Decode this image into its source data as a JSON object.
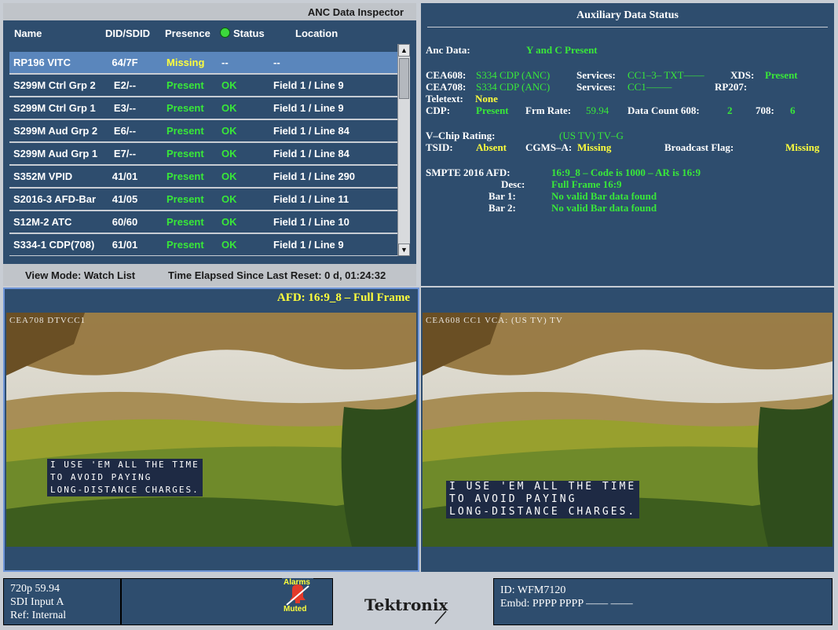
{
  "anc_inspector": {
    "title": "ANC Data Inspector",
    "headers": {
      "name": "Name",
      "did": "DID/SDID",
      "presence": "Presence",
      "status": "Status",
      "location": "Location"
    },
    "rows": [
      {
        "name": "RP196 VITC",
        "did": "64/7F",
        "presence": "Missing",
        "status": "--",
        "location": "--"
      },
      {
        "name": "S299M Ctrl Grp 2",
        "did": "E2/--",
        "presence": "Present",
        "status": "OK",
        "location": "Field 1 / Line 9"
      },
      {
        "name": "S299M Ctrl Grp 1",
        "did": "E3/--",
        "presence": "Present",
        "status": "OK",
        "location": "Field 1 / Line 9"
      },
      {
        "name": "S299M Aud Grp 2",
        "did": "E6/--",
        "presence": "Present",
        "status": "OK",
        "location": "Field 1 / Line 84"
      },
      {
        "name": "S299M Aud Grp 1",
        "did": "E7/--",
        "presence": "Present",
        "status": "OK",
        "location": "Field 1 / Line 84"
      },
      {
        "name": "S352M VPID",
        "did": "41/01",
        "presence": "Present",
        "status": "OK",
        "location": "Field 1 / Line 290"
      },
      {
        "name": "S2016-3 AFD-Bar",
        "did": "41/05",
        "presence": "Present",
        "status": "OK",
        "location": "Field 1 / Line 11"
      },
      {
        "name": "S12M-2 ATC",
        "did": "60/60",
        "presence": "Present",
        "status": "OK",
        "location": "Field 1 / Line 10"
      },
      {
        "name": "S334-1 CDP(708)",
        "did": "61/01",
        "presence": "Present",
        "status": "OK",
        "location": "Field 1 / Line 9"
      }
    ],
    "view_mode": "View Mode: Watch List",
    "time_elapsed": "Time Elapsed Since Last Reset: 0 d, 01:24:32"
  },
  "aux_status": {
    "title": "Auxiliary Data Status",
    "anc_data_label": "Anc Data:",
    "anc_data_value": "Y and C Present",
    "cea608_label": "CEA608:",
    "cea608_value": "S334 CDP (ANC)",
    "cea608_services_label": "Services:",
    "cea608_services_value": "CC1–3– TXT––––",
    "xds_label": "XDS:",
    "xds_value": "Present",
    "cea708_label": "CEA708:",
    "cea708_value": "S334 CDP (ANC)",
    "cea708_services_label": "Services:",
    "cea708_services_value": "CC1–––––",
    "rp207_label": "RP207:",
    "teletext_label": "Teletext:",
    "teletext_value": "None",
    "cdp_label": "CDP:",
    "cdp_value": "Present",
    "frm_rate_label": "Frm Rate:",
    "frm_rate_value": "59.94",
    "data_count_label": "Data Count 608:",
    "data_count_608": "2",
    "data_count_708_label": "708:",
    "data_count_708": "6",
    "vchip_label": "V–Chip Rating:",
    "vchip_value": "(US TV) TV–G",
    "tsid_label": "TSID:",
    "tsid_value": "Absent",
    "cgms_label": "CGMS–A:",
    "cgms_value": "Missing",
    "broadcast_flag_label": "Broadcast Flag:",
    "broadcast_flag_value": "Missing",
    "afd_label": "SMPTE 2016 AFD:",
    "afd_value": "16:9_8 – Code is 1000 – AR is 16:9",
    "desc_label": "Desc:",
    "desc_value": "Full Frame 16:9",
    "bar1_label": "Bar 1:",
    "bar1_value": "No valid Bar data found",
    "bar2_label": "Bar 2:",
    "bar2_value": "No valid Bar data found"
  },
  "left_video": {
    "afd_label": "AFD: 16:9_8 – Full Frame",
    "overlay": "CEA708 DTVCC1",
    "caption_lines": [
      "I USE 'EM ALL THE TIME",
      "TO AVOID PAYING",
      "LONG-DISTANCE CHARGES."
    ]
  },
  "right_video": {
    "overlay": "CEA608 CC1   VCA: (US TV) TV",
    "caption_lines": [
      "I  USE  'EM  ALL  THE  TIME",
      "TO  AVOID  PAYING",
      "LONG-DISTANCE  CHARGES."
    ]
  },
  "bottom": {
    "format": "720p 59.94",
    "input": "SDI Input A",
    "ref": "Ref: Internal",
    "alarms_top": "Alarms",
    "alarms_bottom": "Muted",
    "brand": "Tektronix",
    "id": "ID: WFM7120",
    "embd": "Embd: PPPP PPPP –––– ––––"
  },
  "colors": {
    "panel": "#2e4d6e",
    "present": "#39e839",
    "warning": "#ffff3c",
    "selected_row": "#5a86bc",
    "afd_border": "#6e95d8"
  }
}
